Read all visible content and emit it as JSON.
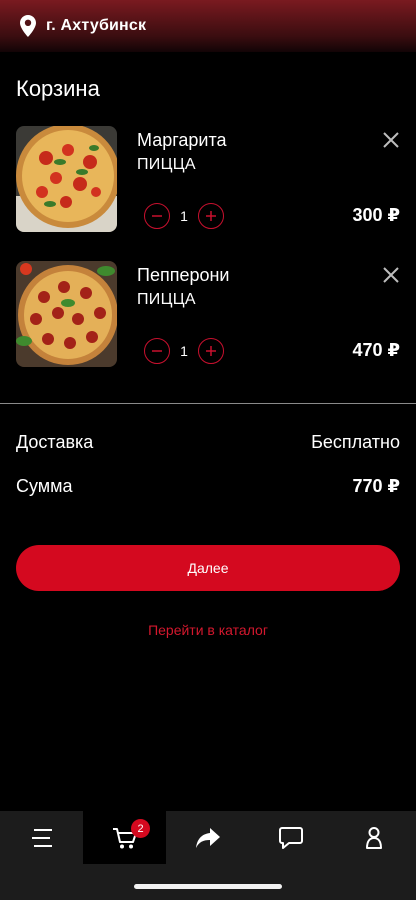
{
  "header": {
    "city": "г. Ахтубинск",
    "icon": "location-pin-icon"
  },
  "cart": {
    "title": "Корзина",
    "items": [
      {
        "name": "Маргарита",
        "category": "ПИЦЦА",
        "qty": "1",
        "price": "300 ₽",
        "image": "margherita-pizza-photo"
      },
      {
        "name": "Пепперони",
        "category": "ПИЦЦА",
        "qty": "1",
        "price": "470 ₽",
        "image": "pepperoni-pizza-photo"
      }
    ]
  },
  "summary": {
    "delivery_label": "Доставка",
    "delivery_value": "Бесплатно",
    "total_label": "Сумма",
    "total_value": "770 ₽"
  },
  "actions": {
    "next_label": "Далее",
    "catalog_label": "Перейти в каталог"
  },
  "tabbar": {
    "tabs": [
      "menu-icon",
      "cart-icon",
      "share-icon",
      "chat-icon",
      "profile-icon"
    ],
    "cart_badge": "2",
    "active": "cart"
  },
  "colors": {
    "accent": "#d4091f",
    "background": "#000000",
    "tabbar": "#1c1c1c"
  }
}
